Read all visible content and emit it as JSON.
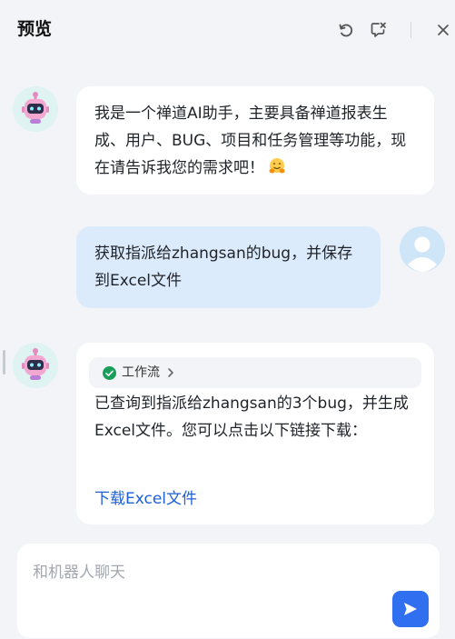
{
  "header": {
    "title": "预览",
    "icons": [
      "refresh-icon",
      "clear-chat-icon",
      "close-icon"
    ]
  },
  "messages": [
    {
      "role": "bot",
      "avatar": "robot-avatar",
      "text": "我是一个禅道AI助手，主要具备禅道报表生成、用户、BUG、项目和任务管理等功能，现在请告诉我您的需求吧！",
      "emoji": "hugging-face-emoji"
    },
    {
      "role": "user",
      "avatar": "user-avatar",
      "text": "获取指派给zhangsan的bug，并保存到Excel文件"
    },
    {
      "role": "bot",
      "avatar": "robot-avatar",
      "workflow_label": "工作流",
      "workflow_status": "success",
      "text": "已查询到指派给zhangsan的3个bug，并生成Excel文件。您可以点击以下链接下载：",
      "link_text": "下载Excel文件"
    }
  ],
  "composer": {
    "placeholder": "和机器人聊天",
    "value": "",
    "send_icon": "send-icon"
  },
  "colors": {
    "background": "#f2f4f7",
    "accent": "#2f6ff0",
    "link": "#1e5fd6",
    "user_bubble": "#dcebfb",
    "success": "#1a9e5a"
  }
}
